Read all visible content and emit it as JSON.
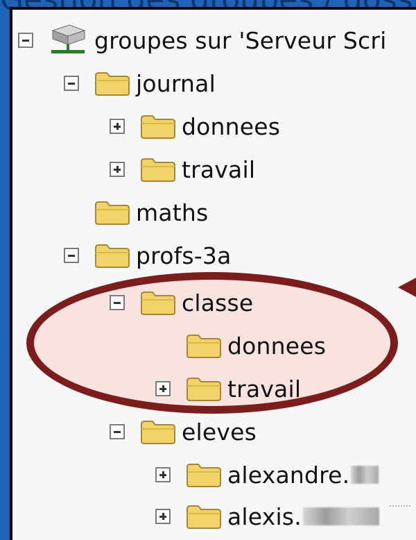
{
  "banner": {
    "text": "Gestion des groupes / dossiers partagés"
  },
  "tree": {
    "root": {
      "label": "groupes sur 'Serveur Scri"
    },
    "journal": {
      "label": "journal"
    },
    "journal_donnees": {
      "label": "donnees"
    },
    "journal_travail": {
      "label": "travail"
    },
    "maths": {
      "label": "maths"
    },
    "profs3a": {
      "label": "profs-3a"
    },
    "classe": {
      "label": "classe"
    },
    "classe_donnees": {
      "label": "donnees"
    },
    "classe_travail": {
      "label": "travail"
    },
    "eleves": {
      "label": "eleves"
    },
    "alexandre": {
      "label": "alexandre."
    },
    "alexis": {
      "label": "alexis."
    }
  },
  "colors": {
    "background": "#1e63b8",
    "highlight_stroke": "#7b1d1d",
    "highlight_fill": "#fad4ce",
    "folder": "#f2d36a"
  },
  "icons": {
    "server": "server-icon",
    "folder": "folder-icon",
    "expand": "plus-icon",
    "collapse": "minus-icon"
  }
}
